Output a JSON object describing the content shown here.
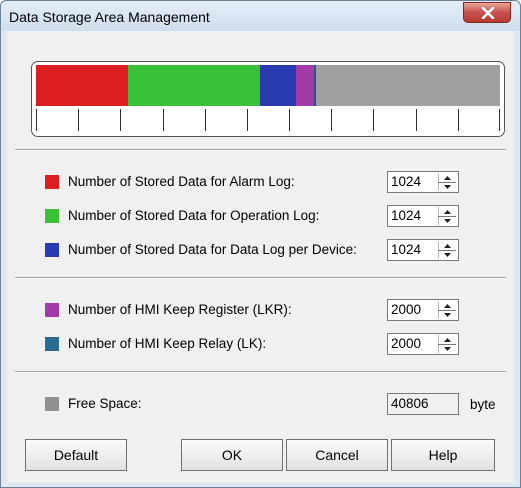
{
  "window": {
    "title": "Data Storage Area Management"
  },
  "storage_bar": {
    "segments": [
      {
        "name": "alarm-log",
        "color": "#dc1e22",
        "fraction": 0.198
      },
      {
        "name": "operation-log",
        "color": "#3ac13a",
        "fraction": 0.285
      },
      {
        "name": "data-log",
        "color": "#2a3ab0",
        "fraction": 0.078
      },
      {
        "name": "keep-register",
        "color": "#a23aa7",
        "fraction": 0.039
      },
      {
        "name": "keep-relay",
        "color": "#1f5a84",
        "fraction": 0.004
      },
      {
        "name": "free-space",
        "color": "#a0a0a0",
        "fraction": 0.396
      }
    ],
    "tick_count": 12
  },
  "rows": {
    "alarm_log": {
      "label": "Number of Stored Data for Alarm Log:",
      "value": "1024",
      "color": "#dc1e22"
    },
    "operation_log": {
      "label": "Number of Stored Data for Operation Log:",
      "value": "1024",
      "color": "#3ac13a"
    },
    "data_log": {
      "label": "Number of Stored Data for Data Log per Device:",
      "value": "1024",
      "color": "#2a3ab0"
    },
    "keep_register": {
      "label": "Number of HMI Keep Register (LKR):",
      "value": "2000",
      "color": "#a23aa7"
    },
    "keep_relay": {
      "label": "Number of HMI Keep Relay (LK):",
      "value": "2000",
      "color": "#2b6a90"
    },
    "free_space": {
      "label": "Free Space:",
      "value": "40806",
      "unit": "byte",
      "color": "#909090"
    }
  },
  "buttons": {
    "default": "Default",
    "ok": "OK",
    "cancel": "Cancel",
    "help": "Help"
  }
}
